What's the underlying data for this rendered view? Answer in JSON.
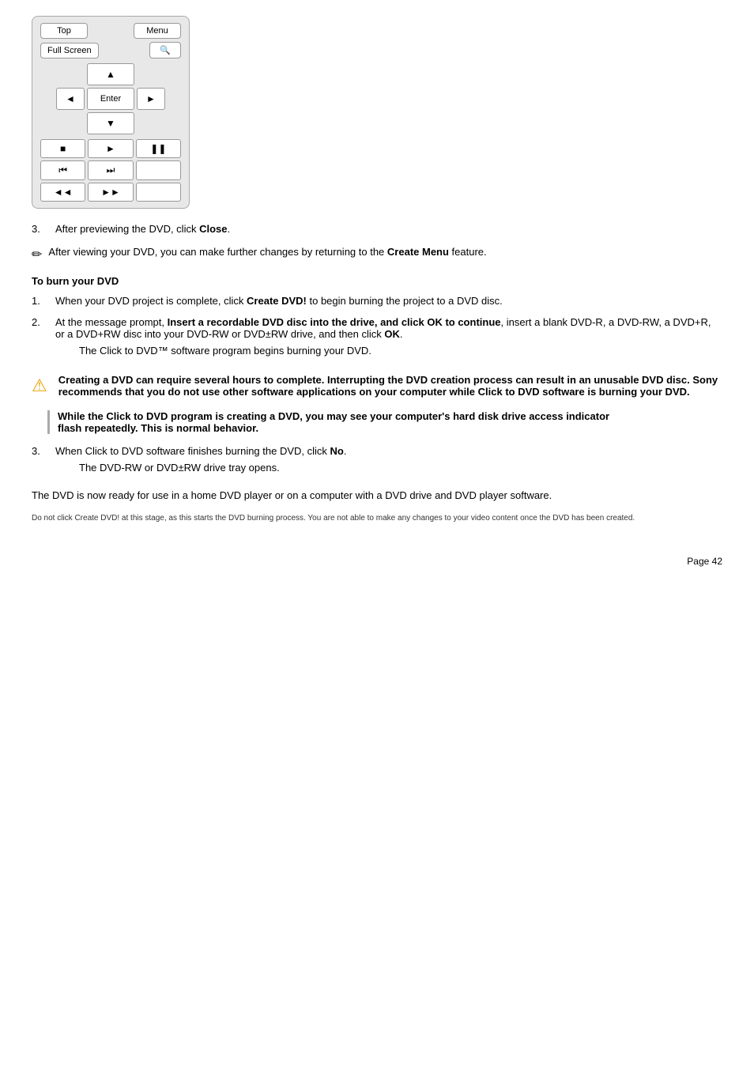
{
  "remote": {
    "top_label": "Top",
    "menu_label": "Menu",
    "fullscreen_label": "Full Screen",
    "fullscreen_icon": "🔍",
    "up_icon": "▲",
    "left_icon": "◄",
    "enter_label": "Enter",
    "right_icon": "►",
    "down_icon": "▼",
    "stop_icon": "■",
    "play_icon": "►",
    "pause_icon": "❚❚",
    "prev_chapter_icon": "⏮",
    "next_chapter_icon": "⏭",
    "rewind_icon": "◄◄",
    "ffwd_icon": "►►"
  },
  "steps": {
    "step3_text": "After previewing the DVD, click ",
    "step3_bold": "Close",
    "step3_end": "."
  },
  "note1": {
    "icon": "✏",
    "text": "After viewing your DVD, you can make further changes by returning to the ",
    "bold": "Create Menu",
    "end": " feature."
  },
  "burn_section": {
    "heading": "To burn your DVD",
    "step1_text": "When your DVD project is complete, click ",
    "step1_bold": "Create DVD!",
    "step1_end": " to begin burning the project to a DVD disc.",
    "step2_text": "At the message prompt, ",
    "step2_bold": "Insert a recordable DVD disc into the drive, and click OK to continue",
    "step2_end": ", insert a blank DVD-R, a DVD-RW, a DVD+R, or a DVD+RW disc into your DVD-RW or DVD±RW drive, and then click ",
    "step2_ok": "OK",
    "step2_period": ".",
    "click_dvd_text": "The Click to DVD™ software program begins burning your DVD.",
    "warning_bold": "Creating a DVD can require several hours to complete. Interrupting the DVD creation process can result in an unusable DVD disc. Sony recommends that you do not use other software applications on your computer while Click to DVD software is burning your DVD.",
    "info_bold_line1": "While the Click to DVD program is creating a DVD, you may see your computer's hard disk drive access indicator",
    "info_bold_line2": "flash repeatedly. This is normal behavior.",
    "step3_text": "When Click to DVD software finishes burning the DVD, click ",
    "step3_bold": "No",
    "step3_end": ".",
    "tray_text": "The DVD-RW or DVD±RW drive tray opens."
  },
  "final_note": "The DVD is now ready for use in a home DVD player or on a computer with a DVD drive and DVD player software.",
  "small_note": "Do not click Create DVD! at this stage, as this starts the DVD burning process. You are not able to make any changes to your video content once the DVD has been created.",
  "page_number": "Page 42"
}
